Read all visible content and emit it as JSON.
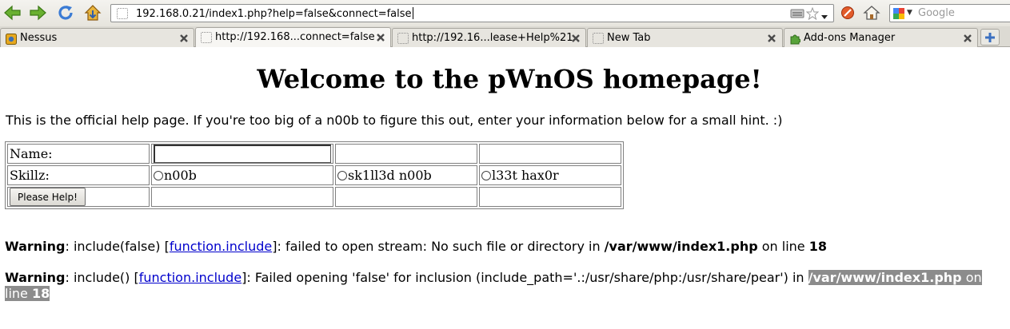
{
  "toolbar": {
    "url": "192.168.0.21/index1.php?help=false&connect=false",
    "search_placeholder": "Google",
    "icons": [
      "back-icon",
      "forward-icon",
      "reload-icon",
      "home-download-icon",
      "rss-icon",
      "star-icon",
      "stop-icon",
      "home-icon",
      "google-search-icon"
    ]
  },
  "tabs": [
    {
      "label": "Nessus",
      "icon": "nessus-icon"
    },
    {
      "label": "http://192.168...connect=false",
      "icon": "blank-page-icon"
    },
    {
      "label": "http://192.16...lease+Help%21",
      "icon": "blank-page-icon"
    },
    {
      "label": "New Tab",
      "icon": "blank-page-icon"
    },
    {
      "label": "Add-ons Manager",
      "icon": "puzzle-icon"
    }
  ],
  "page": {
    "title": "Welcome to the pWnOS homepage!",
    "intro": "This is the official help page. If you're too big of a n00b to figure this out, enter your information below for a small hint. :)",
    "form": {
      "name_label": "Name:",
      "name_value": "",
      "skill_label": "Skillz:",
      "skills": [
        "n00b",
        "sk1ll3d n00b",
        "l33t hax0r"
      ],
      "submit_label": "Please Help!"
    },
    "warnings": [
      {
        "label": "Warning",
        "pre": ": include(false) [",
        "link": "function.include",
        "post": "]: failed to open stream: No such file or directory in ",
        "file": "/var/www/index1.php",
        "on_line": " on line ",
        "line": "18"
      },
      {
        "label": "Warning",
        "pre": ": include() [",
        "link": "function.include",
        "post": "]: Failed opening 'false' for inclusion (include_path='.:/usr/share/php:/usr/share/pear') in ",
        "file": "/var/www/index1.php",
        "on_line": " on line ",
        "line": "18"
      }
    ]
  },
  "colors": {
    "link": "#0000cc",
    "selection": "#8c8c8c",
    "nav_green": "#5aa028",
    "reload_blue": "#3b7bd4"
  }
}
